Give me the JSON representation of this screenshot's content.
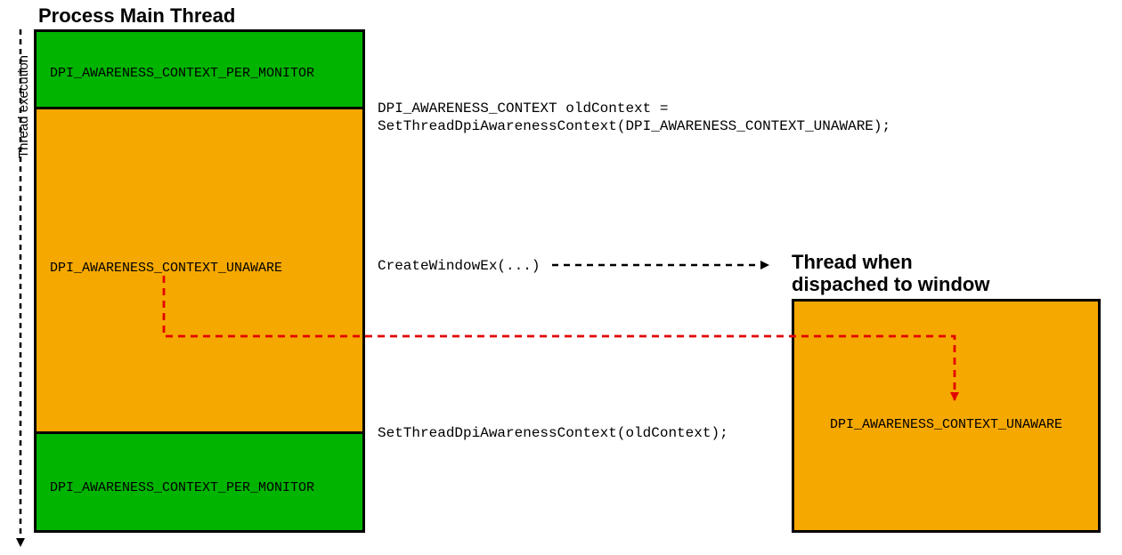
{
  "titles": {
    "main": "Process Main Thread",
    "thread2_line1": "Thread when",
    "thread2_line2": "dispached to window"
  },
  "blocks": {
    "green_top": "DPI_AWARENESS_CONTEXT_PER_MONITOR",
    "orange_big": "DPI_AWARENESS_CONTEXT_UNAWARE",
    "green_bottom": "DPI_AWARENESS_CONTEXT_PER_MONITOR",
    "orange_window": "DPI_AWARENESS_CONTEXT_UNAWARE"
  },
  "code": {
    "line1": "DPI_AWARENESS_CONTEXT oldContext =",
    "line2": "SetThreadDpiAwarenessContext(DPI_AWARENESS_CONTEXT_UNAWARE);",
    "createwin": "CreateWindowEx(...)",
    "reset": "SetThreadDpiAwarenessContext(oldContext);"
  },
  "axis": {
    "label": "Thread execution"
  }
}
